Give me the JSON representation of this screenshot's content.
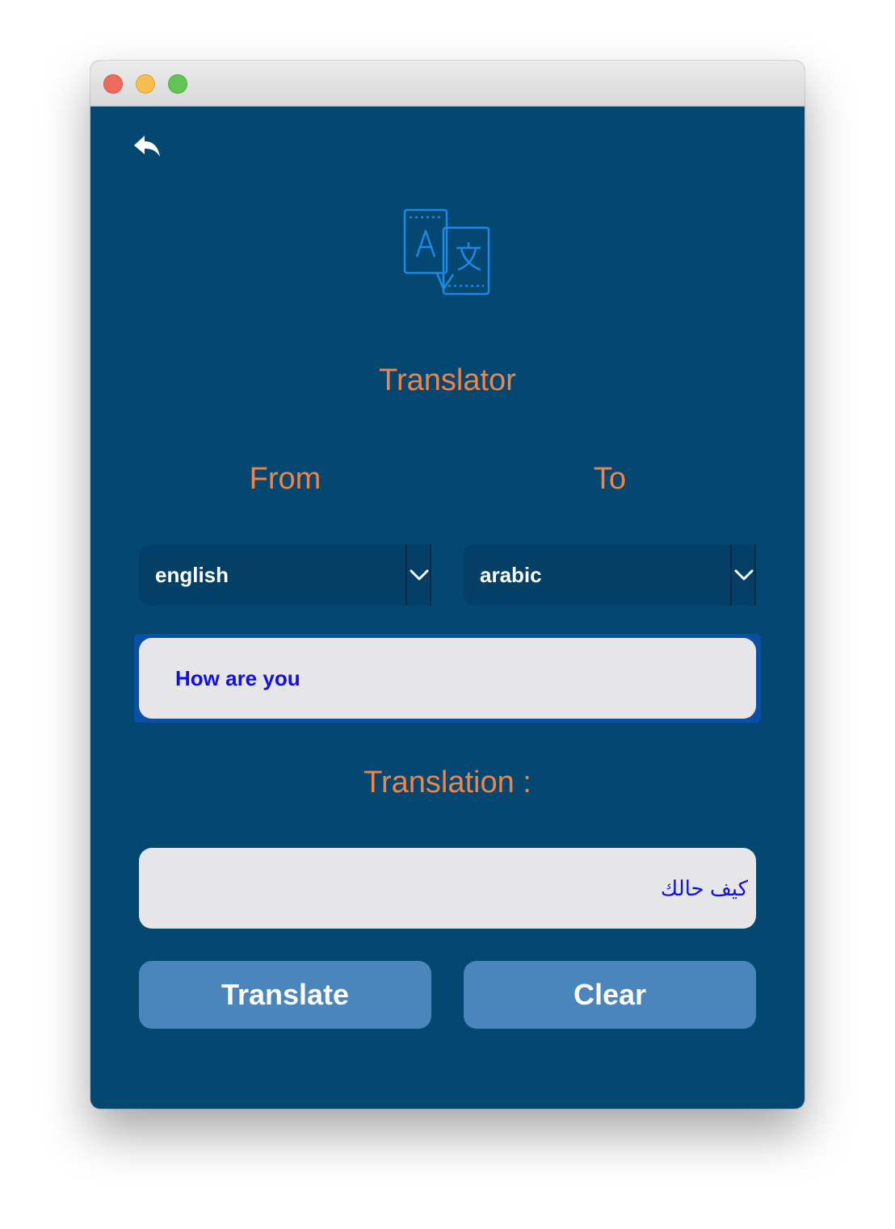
{
  "app": {
    "title": "Translator"
  },
  "icons": {
    "back": "reply-arrow-icon",
    "logo": "translate-icon",
    "dropdown": "chevron-down-icon"
  },
  "labels": {
    "from": "From",
    "to": "To",
    "translation": "Translation :"
  },
  "source_language": {
    "selected": "english"
  },
  "target_language": {
    "selected": "arabic"
  },
  "input": {
    "value": "How are you"
  },
  "output": {
    "value": "كيف حالك"
  },
  "buttons": {
    "translate": "Translate",
    "clear": "Clear"
  },
  "colors": {
    "background": "#044872",
    "accent_text": "#f08345",
    "button": "#4a86bc",
    "field_text": "#0f0fe6",
    "logo": "#1e88e5"
  }
}
